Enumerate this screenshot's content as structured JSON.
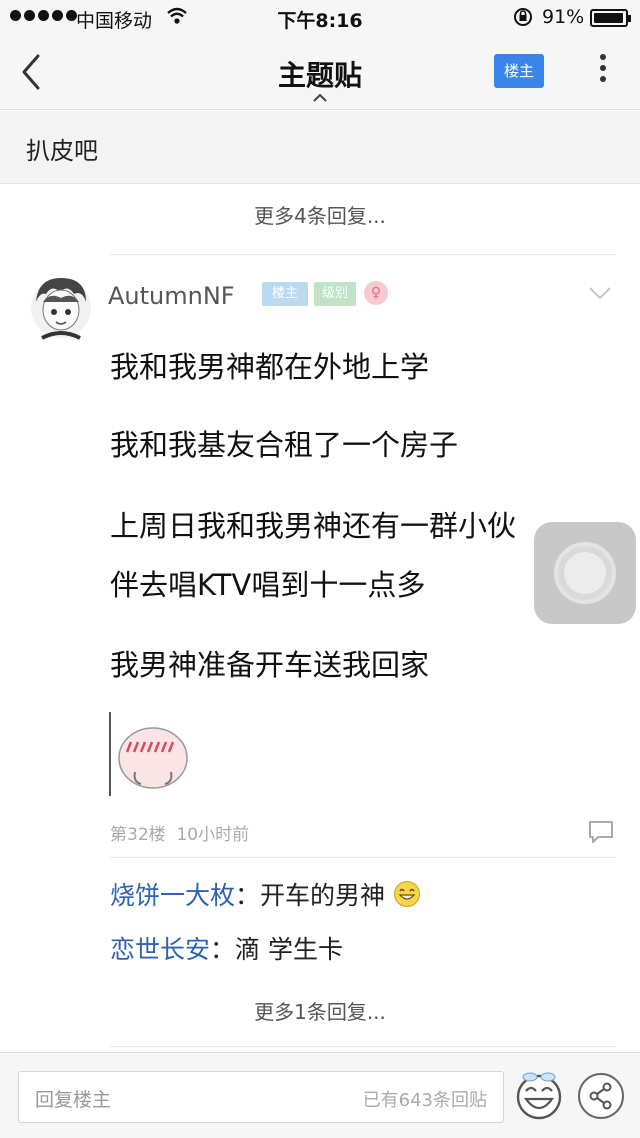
{
  "status": {
    "carrier": "中国移动",
    "time": "下午8:16",
    "battery": "91%",
    "battery_level": 0.91
  },
  "nav": {
    "title": "主题贴",
    "louzhu_button": "楼主"
  },
  "forum": {
    "name": "扒皮吧"
  },
  "more_replies_top": "更多4条回复...",
  "post": {
    "username": "AutumnNF",
    "badges": [
      "楼主",
      "级别"
    ],
    "lines": [
      "我和我男神都在外地上学",
      "我和我基友合租了一个房子",
      "上周日我和我男神还有一群小伙",
      "伴去唱KTV唱到十一点多",
      "我男神准备开车送我回家"
    ],
    "floor": "第32楼",
    "time": "10小时前"
  },
  "replies": [
    {
      "user": "烧饼一大枚",
      "sep": "：",
      "text": "开车的男神"
    },
    {
      "user": "恋世长安",
      "sep": "：",
      "text": "滴 学生卡"
    }
  ],
  "more_replies_bottom": "更多1条回复...",
  "bottom": {
    "placeholder": "回复楼主",
    "count": "已有643条回贴"
  },
  "icons": {
    "back": "chevron-left-icon",
    "more": "more-vertical-icon",
    "caret": "caret-up-icon",
    "comment": "comment-icon",
    "emoji": "emoji-icon",
    "share": "share-icon",
    "gender": "female-icon"
  },
  "colors": {
    "accent": "#3a86e8",
    "reply_user": "#2f63b0"
  }
}
